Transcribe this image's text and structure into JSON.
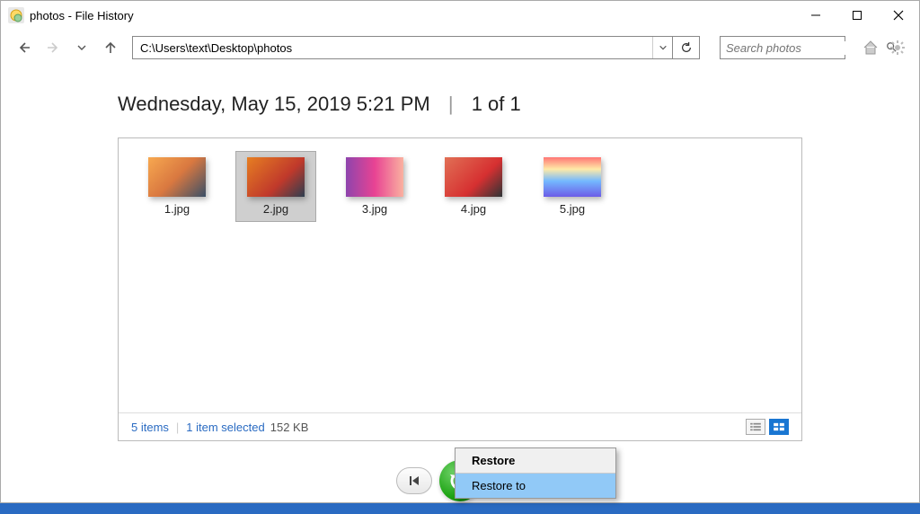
{
  "window": {
    "title": "photos - File History"
  },
  "toolbar": {
    "address": "C:\\Users\\text\\Desktop\\photos",
    "search_placeholder": "Search photos"
  },
  "heading": {
    "datetime": "Wednesday, May 15, 2019 5:21 PM",
    "page_indicator": "1 of 1"
  },
  "files": [
    {
      "name": "1.jpg",
      "selected": false,
      "thumb_class": "thumb1"
    },
    {
      "name": "2.jpg",
      "selected": true,
      "thumb_class": "thumb2"
    },
    {
      "name": "3.jpg",
      "selected": false,
      "thumb_class": "thumb3"
    },
    {
      "name": "4.jpg",
      "selected": false,
      "thumb_class": "thumb4"
    },
    {
      "name": "5.jpg",
      "selected": false,
      "thumb_class": "thumb5"
    }
  ],
  "status": {
    "count_text": "5 items",
    "selection_text": "1 item selected",
    "size_text": "152 KB"
  },
  "context_menu": {
    "items": [
      {
        "label": "Restore",
        "bold": true,
        "highlighted": false
      },
      {
        "label": "Restore to",
        "bold": false,
        "highlighted": true
      }
    ]
  }
}
